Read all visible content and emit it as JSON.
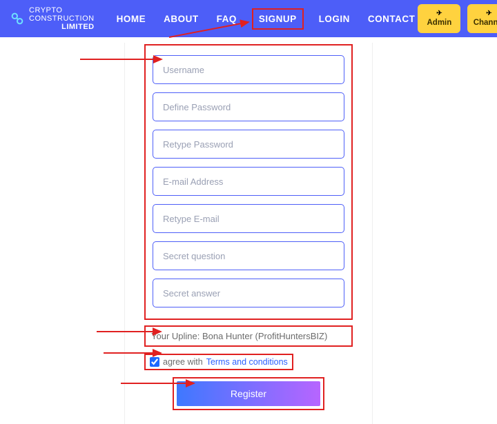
{
  "brand": {
    "line1": "CRYPTO CONSTRUCTION",
    "line2": "LIMITED"
  },
  "nav": {
    "home": "HOME",
    "about": "ABOUT",
    "faq": "FAQ",
    "signup": "SIGNUP",
    "login": "LOGIN",
    "contact": "CONTACT"
  },
  "cta": {
    "admin": "Admin",
    "channel": "Channel"
  },
  "form": {
    "username": "Username",
    "password": "Define Password",
    "retype_password": "Retype Password",
    "email": "E-mail Address",
    "retype_email": "Retype E-mail",
    "secret_q": "Secret question",
    "secret_a": "Secret answer"
  },
  "upline": "Your Upline: Bona Hunter (ProfitHuntersBIZ)",
  "terms": {
    "label": "agree with ",
    "link": "Terms and conditions",
    "checked": true
  },
  "register": "Register"
}
